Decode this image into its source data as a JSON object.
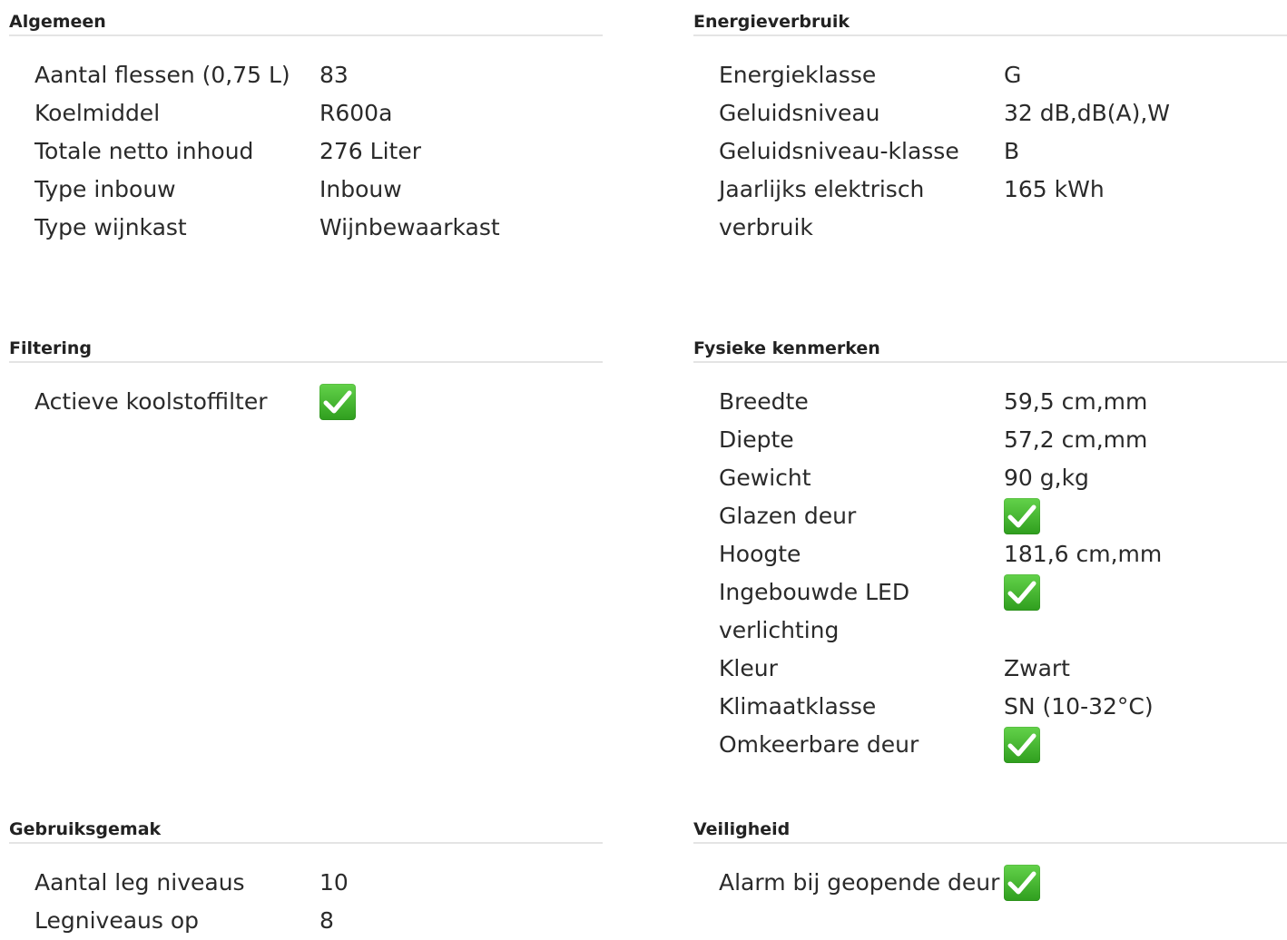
{
  "sections": {
    "algemeen": {
      "title": "Algemeen",
      "rows": [
        {
          "label": "Aantal flessen (0,75 L)",
          "value": "83"
        },
        {
          "label": "Koelmiddel",
          "value": "R600a"
        },
        {
          "label": "Totale netto inhoud",
          "value": "276 Liter"
        },
        {
          "label": "Type inbouw",
          "value": "Inbouw"
        },
        {
          "label": "Type wijnkast",
          "value": "Wijnbewaarkast"
        }
      ]
    },
    "energieverbruik": {
      "title": "Energieverbruik",
      "rows": [
        {
          "label": "Energieklasse",
          "value": "G"
        },
        {
          "label": "Geluidsniveau",
          "value": "32 dB,dB(A),W"
        },
        {
          "label": "Geluidsniveau-klasse",
          "value": "B"
        },
        {
          "label": "Jaarlijks elektrisch verbruik",
          "value": "165 kWh"
        }
      ]
    },
    "filtering": {
      "title": "Filtering",
      "rows": [
        {
          "label": "Actieve koolstoffilter",
          "value": "check-icon"
        }
      ]
    },
    "fysieke": {
      "title": "Fysieke kenmerken",
      "rows": [
        {
          "label": "Breedte",
          "value": "59,5 cm,mm"
        },
        {
          "label": "Diepte",
          "value": "57,2 cm,mm"
        },
        {
          "label": "Gewicht",
          "value": "90 g,kg"
        },
        {
          "label": "Glazen deur",
          "value": "check-icon"
        },
        {
          "label": "Hoogte",
          "value": "181,6 cm,mm"
        },
        {
          "label": "Ingebouwde LED verlichting",
          "value": "check-icon"
        },
        {
          "label": "Kleur",
          "value": "Zwart"
        },
        {
          "label": "Klimaatklasse",
          "value": "SN (10-32°C)"
        },
        {
          "label": "Omkeerbare deur",
          "value": "check-icon"
        }
      ]
    },
    "gebruiksgemak": {
      "title": "Gebruiksgemak",
      "rows": [
        {
          "label": "Aantal leg niveaus",
          "value": "10"
        },
        {
          "label": "Legniveaus op",
          "value": "8"
        }
      ]
    },
    "veiligheid": {
      "title": "Veiligheid",
      "rows": [
        {
          "label": "Alarm bij geopende deur",
          "value": "check-icon"
        }
      ]
    }
  },
  "colors": {
    "check_green": "#3fb52c",
    "divider": "#e4e4e4"
  }
}
